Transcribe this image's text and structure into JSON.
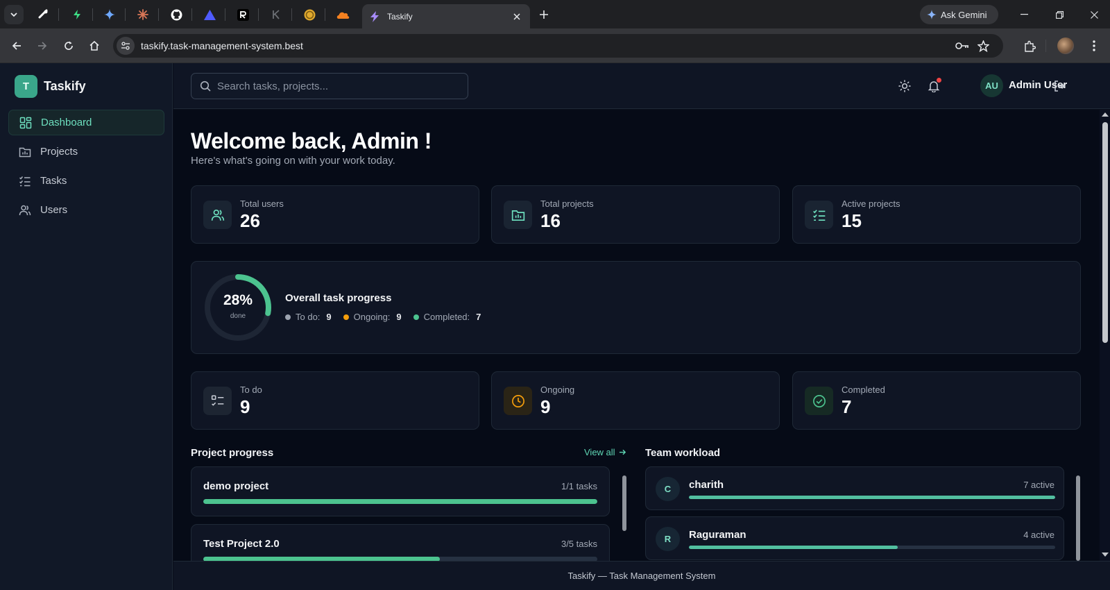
{
  "browser": {
    "active_tab_title": "Taskify",
    "url": "taskify.task-management-system.best",
    "gemini_label": "Ask Gemini"
  },
  "app": {
    "brand_letter": "T",
    "brand_name": "Taskify",
    "nav": [
      {
        "label": "Dashboard",
        "icon": "dashboard-icon",
        "active": true
      },
      {
        "label": "Projects",
        "icon": "folder-chart-icon",
        "active": false
      },
      {
        "label": "Tasks",
        "icon": "checklist-icon",
        "active": false
      },
      {
        "label": "Users",
        "icon": "users-icon",
        "active": false
      }
    ],
    "search_placeholder": "Search tasks, projects...",
    "user_initials": "AU",
    "user_name": "Admin User"
  },
  "dashboard": {
    "welcome": "Welcome back, Admin !",
    "subtitle": "Here's what's going on with your work today.",
    "stats": [
      {
        "label": "Total users",
        "value": "26",
        "icon": "users-icon"
      },
      {
        "label": "Total projects",
        "value": "16",
        "icon": "folder-chart-icon"
      },
      {
        "label": "Active projects",
        "value": "15",
        "icon": "checklist-icon"
      }
    ],
    "progress": {
      "title": "Overall task progress",
      "percent_label": "28%",
      "percent": 28,
      "done_label": "done",
      "legend": [
        {
          "label": "To do:",
          "value": "9",
          "color": "#9ca3af"
        },
        {
          "label": "Ongoing:",
          "value": "9",
          "color": "#f59e0b"
        },
        {
          "label": "Completed:",
          "value": "7",
          "color": "#4cc38f"
        }
      ]
    },
    "status_cards": [
      {
        "label": "To do",
        "value": "9",
        "icon": "list-check-icon"
      },
      {
        "label": "Ongoing",
        "value": "9",
        "icon": "clock-icon"
      },
      {
        "label": "Completed",
        "value": "7",
        "icon": "check-circle-icon"
      }
    ],
    "project_progress_title": "Project progress",
    "view_all": "View all",
    "projects": [
      {
        "name": "demo project",
        "count": "1/1 tasks",
        "fraction": 1.0
      },
      {
        "name": "Test Project 2.0",
        "count": "3/5 tasks",
        "fraction": 0.6
      }
    ],
    "team_workload_title": "Team workload",
    "team": [
      {
        "initial": "C",
        "name": "charith",
        "count": "7 active",
        "fraction": 1.0
      },
      {
        "initial": "R",
        "name": "Raguraman",
        "count": "4 active",
        "fraction": 0.57
      }
    ],
    "footer": "Taskify — Task Management System"
  },
  "colors": {
    "accent": "#4cc38f",
    "accent_text": "#6ee0bf",
    "ongoing": "#f59e0b",
    "notification": "#ef4444"
  }
}
